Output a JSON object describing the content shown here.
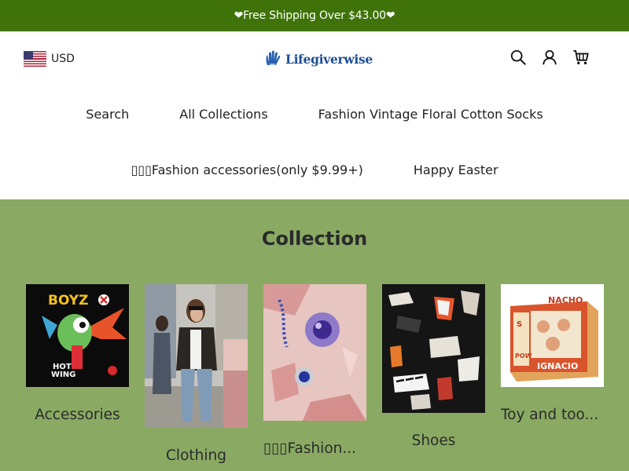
{
  "announcement": {
    "text": "❤Free Shipping Over $43.00❤"
  },
  "header": {
    "currency": "USD",
    "logo_text": "Lifegiverwise",
    "icons": [
      "search-icon",
      "account-icon",
      "cart-icon"
    ]
  },
  "nav": {
    "row1": [
      "Search",
      "All Collections",
      "Fashion Vintage Floral Cotton Socks"
    ],
    "row2": [
      "▯▯▯Fashion accessories(only $9.99+)",
      "Happy Easter"
    ]
  },
  "collection": {
    "title": "Collection",
    "items": [
      {
        "label": "Accessories"
      },
      {
        "label": "Clothing"
      },
      {
        "label": "▯▯▯Fashion..."
      },
      {
        "label": "Shoes"
      },
      {
        "label": "Toy and too..."
      }
    ]
  },
  "colors": {
    "announcement_bg": "#3f7309",
    "section_bg": "#8aaa64",
    "logo_blue": "#1f4f95"
  }
}
